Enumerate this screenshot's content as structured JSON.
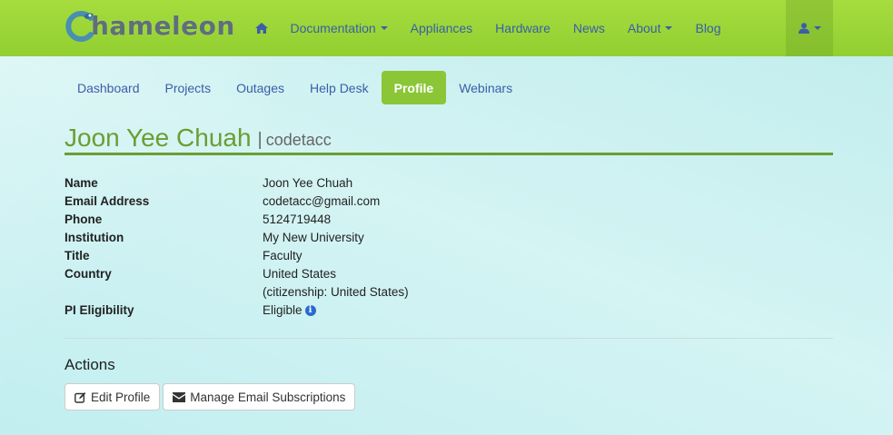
{
  "navbar": {
    "logo_text": "hameleon",
    "items": [
      {
        "label": "Documentation",
        "dropdown": true
      },
      {
        "label": "Appliances",
        "dropdown": false
      },
      {
        "label": "Hardware",
        "dropdown": false
      },
      {
        "label": "News",
        "dropdown": false
      },
      {
        "label": "About",
        "dropdown": true
      },
      {
        "label": "Blog",
        "dropdown": false
      }
    ]
  },
  "subnav": {
    "items": [
      "Dashboard",
      "Projects",
      "Outages",
      "Help Desk",
      "Profile",
      "Webinars"
    ],
    "active": "Profile"
  },
  "profile": {
    "full_name": "Joon Yee Chuah",
    "separator": "|",
    "username": "codetacc",
    "fields": [
      {
        "label": "Name",
        "value": "Joon Yee Chuah"
      },
      {
        "label": "Email Address",
        "value": "codetacc@gmail.com"
      },
      {
        "label": "Phone",
        "value": "5124719448"
      },
      {
        "label": "Institution",
        "value": "My New University"
      },
      {
        "label": "Title",
        "value": "Faculty"
      },
      {
        "label": "Country",
        "value": "United States",
        "extra": "(citizenship: United States)"
      },
      {
        "label": "PI Eligibility",
        "value": "Eligible"
      }
    ]
  },
  "actions": {
    "title": "Actions",
    "edit_label": "Edit Profile",
    "subscriptions_label": "Manage Email Subscriptions"
  },
  "colors": {
    "navbar_green": "#9ad636",
    "active_tab": "#8bc637",
    "link_blue": "#3a5ea8",
    "title_green": "#6a9e32"
  }
}
